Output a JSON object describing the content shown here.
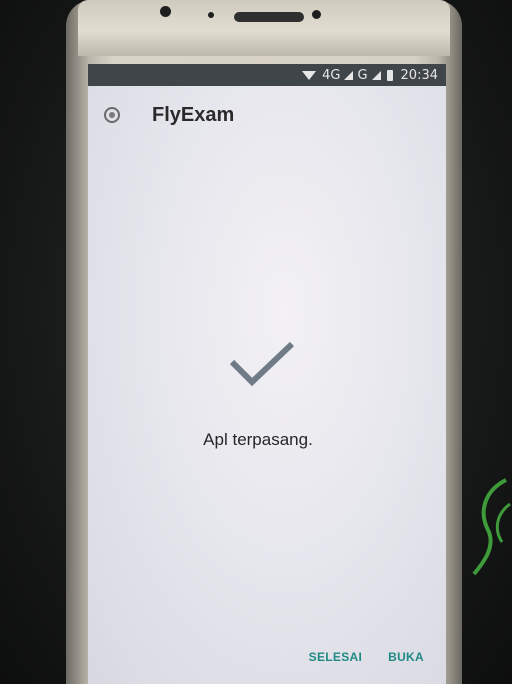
{
  "status_bar": {
    "network_4g": "4G",
    "network_g": "G",
    "time": "20:34"
  },
  "app": {
    "name": "FlyExam",
    "icon": "app-badge-icon"
  },
  "install": {
    "message": "Apl terpasang.",
    "icon": "checkmark-icon"
  },
  "actions": {
    "done_label": "SELESAI",
    "open_label": "BUKA"
  },
  "colors": {
    "accent": "#1f8a84",
    "check": "#6f7c88",
    "status_bar_bg": "#3f4548"
  }
}
